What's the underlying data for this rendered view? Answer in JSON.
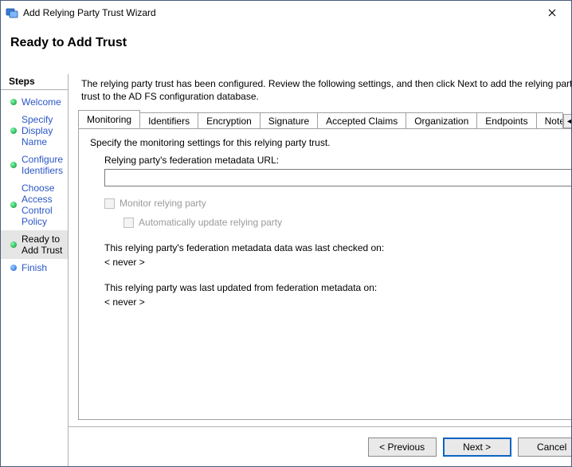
{
  "window": {
    "title": "Add Relying Party Trust Wizard"
  },
  "header": {
    "page_title": "Ready to Add Trust"
  },
  "steps": {
    "heading": "Steps",
    "items": [
      {
        "label": "Welcome",
        "state": "done"
      },
      {
        "label": "Specify Display Name",
        "state": "done"
      },
      {
        "label": "Configure Identifiers",
        "state": "done"
      },
      {
        "label": "Choose Access Control Policy",
        "state": "done"
      },
      {
        "label": "Ready to Add Trust",
        "state": "current"
      },
      {
        "label": "Finish",
        "state": "pending"
      }
    ]
  },
  "content": {
    "intro": "The relying party trust has been configured. Review the following settings, and then click Next to add the relying party trust to the AD FS configuration database.",
    "tabs": [
      {
        "label": "Monitoring",
        "active": true
      },
      {
        "label": "Identifiers"
      },
      {
        "label": "Encryption"
      },
      {
        "label": "Signature"
      },
      {
        "label": "Accepted Claims"
      },
      {
        "label": "Organization"
      },
      {
        "label": "Endpoints"
      },
      {
        "label": "Notes"
      }
    ],
    "monitoring": {
      "desc": "Specify the monitoring settings for this relying party trust.",
      "url_label": "Relying party's federation metadata URL:",
      "url_value": "",
      "monitor_label": "Monitor relying party",
      "autoupdate_label": "Automatically update relying party",
      "last_checked_label": "This relying party's federation metadata data was last checked on:",
      "last_checked_value": "< never >",
      "last_updated_label": "This relying party was last updated from federation metadata on:",
      "last_updated_value": "< never >"
    }
  },
  "buttons": {
    "previous": "< Previous",
    "next": "Next >",
    "cancel": "Cancel"
  }
}
